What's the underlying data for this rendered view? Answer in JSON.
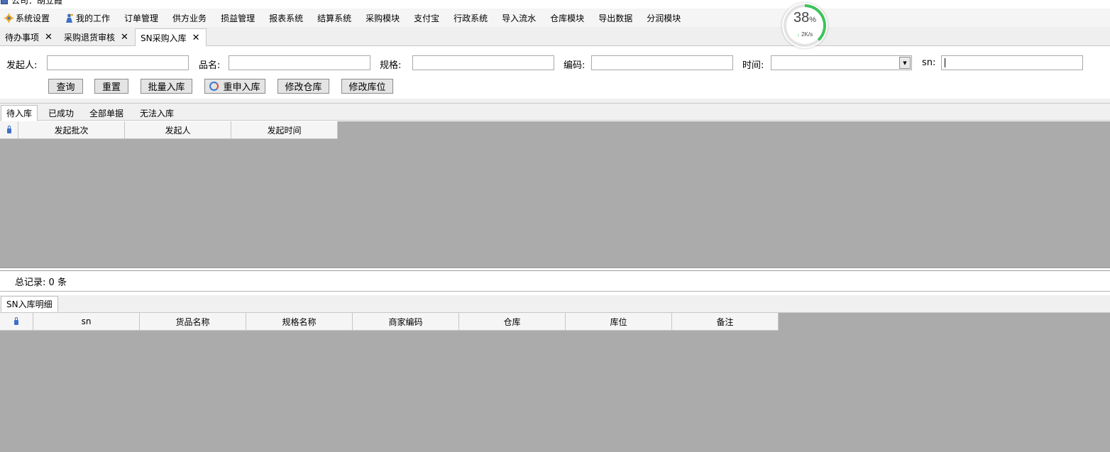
{
  "window": {
    "title": "公司：胡立霞"
  },
  "menu": [
    {
      "label": "系统设置",
      "icon": "gear-icon"
    },
    {
      "label": "我的工作",
      "icon": "worker-icon"
    },
    {
      "label": "订单管理"
    },
    {
      "label": "供方业务"
    },
    {
      "label": "损益管理"
    },
    {
      "label": "报表系统"
    },
    {
      "label": "结算系统"
    },
    {
      "label": "采购模块"
    },
    {
      "label": "支付宝"
    },
    {
      "label": "行政系统"
    },
    {
      "label": "导入流水"
    },
    {
      "label": "仓库模块"
    },
    {
      "label": "导出数据"
    },
    {
      "label": "分润模块"
    }
  ],
  "tabs": [
    {
      "label": "待办事项",
      "close": "✕"
    },
    {
      "label": "采购退货审核",
      "close": "✕"
    },
    {
      "label": "SN采购入库",
      "close": "✕",
      "active": true
    }
  ],
  "search": {
    "initiator_label": "发起人:",
    "initiator_value": "",
    "product_label": "品名:",
    "product_value": "",
    "spec_label": "规格:",
    "spec_value": "",
    "code_label": "编码:",
    "code_value": "",
    "time_label": "时间:",
    "time_value": "",
    "sn_label": "sn:",
    "sn_value": ""
  },
  "buttons": {
    "query": "查询",
    "reset": "重置",
    "batch_in": "批量入库",
    "reapply": "重申入库",
    "modify_warehouse": "修改仓库",
    "modify_location": "修改库位"
  },
  "subtabs": [
    {
      "label": "待入库",
      "active": true
    },
    {
      "label": "已成功"
    },
    {
      "label": "全部单据"
    },
    {
      "label": "无法入库"
    }
  ],
  "grid_top": {
    "columns": [
      "发起批次",
      "发起人",
      "发起时间"
    ]
  },
  "records": {
    "label": "总记录:",
    "count": "0",
    "unit": "条"
  },
  "detail_tab": {
    "label": "SN入库明细"
  },
  "grid_bottom": {
    "columns": [
      "sn",
      "货品名称",
      "规格名称",
      "商家编码",
      "仓库",
      "库位",
      "备注"
    ]
  },
  "speed_widget": {
    "percent": 38,
    "percent_text": "38",
    "percent_sign": "%",
    "arrow": "↓",
    "rate": "2K/s",
    "color": "#3cc35a"
  }
}
